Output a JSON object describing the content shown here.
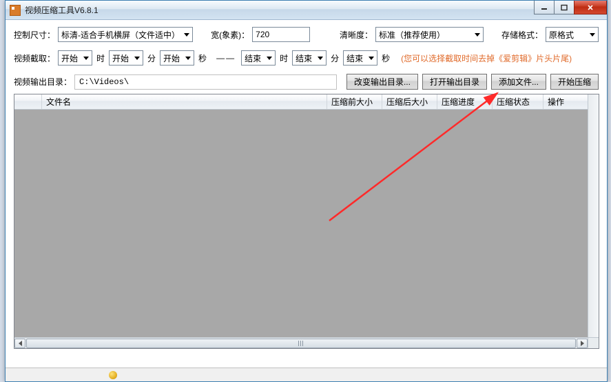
{
  "window": {
    "title": "视频压缩工具V6.8.1"
  },
  "row1": {
    "size_label": "控制尺寸：",
    "size_value": "标清-适合手机横屏（文件适中）",
    "width_label": "宽(象素)：",
    "width_value": "720",
    "clarity_label": "清晰度：",
    "clarity_value": "标准（推荐使用）",
    "storage_label": "存储格式：",
    "storage_value": "原格式"
  },
  "row2": {
    "crop_label": "视频截取：",
    "start": "开始",
    "end": "结束",
    "h": "时",
    "m": "分",
    "s": "秒",
    "dash": "——",
    "hint": "(您可以选择截取时间去掉《爱剪辑》片头片尾)"
  },
  "row3": {
    "outdir_label": "视频输出目录：",
    "outdir_value": "C:\\Videos\\",
    "btn_change": "改变输出目录...",
    "btn_open": "打开输出目录",
    "btn_add": "添加文件...",
    "btn_start": "开始压缩"
  },
  "table": {
    "columns": [
      "文件名",
      "压缩前大小",
      "压缩后大小",
      "压缩进度",
      "压缩状态",
      "操作"
    ]
  }
}
